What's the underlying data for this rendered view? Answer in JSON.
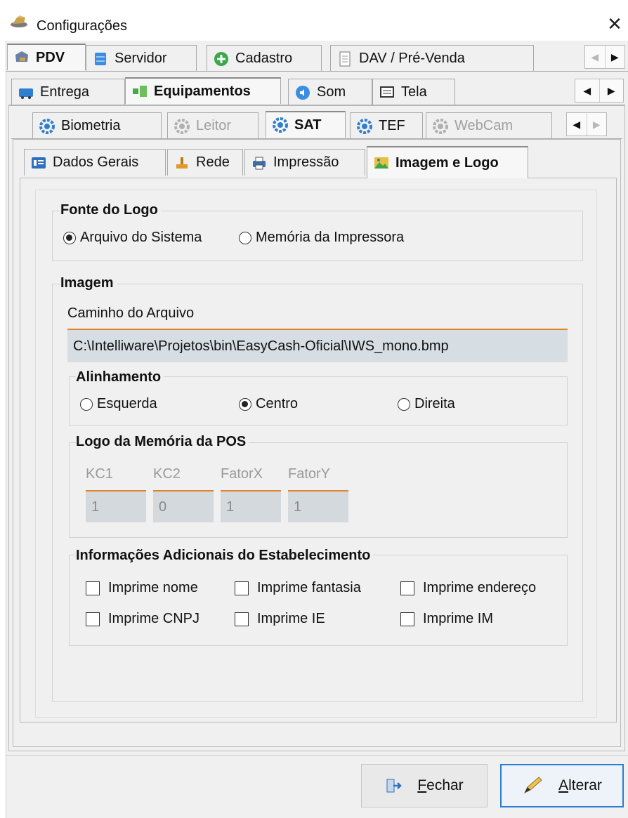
{
  "window": {
    "title": "Configurações",
    "close_glyph": "✕"
  },
  "tabs_level1": [
    {
      "label": "PDV",
      "icon": "pdv-icon",
      "active": true
    },
    {
      "label": "Servidor",
      "icon": "server-icon"
    },
    {
      "label": "Cadastro",
      "icon": "add-green-icon"
    },
    {
      "label": "DAV / Pré-Venda",
      "icon": "document-icon"
    }
  ],
  "tabs_level2": [
    {
      "label": "Entrega",
      "icon": "truck-icon"
    },
    {
      "label": "Equipamentos",
      "icon": "equipment-icon",
      "active": true
    },
    {
      "label": "Som",
      "icon": "sound-icon"
    },
    {
      "label": "Tela",
      "icon": "screen-icon"
    }
  ],
  "tabs_level3": [
    {
      "label": "Biometria",
      "icon": "gear-icon"
    },
    {
      "label": "Leitor",
      "icon": "gear-icon",
      "disabled": true
    },
    {
      "label": "SAT",
      "icon": "gear-icon",
      "active": true
    },
    {
      "label": "TEF",
      "icon": "gear-icon"
    },
    {
      "label": "WebCam",
      "icon": "gear-icon",
      "disabled": true
    }
  ],
  "tabs_level4": [
    {
      "label": "Dados Gerais",
      "icon": "data-icon"
    },
    {
      "label": "Rede",
      "icon": "network-icon"
    },
    {
      "label": "Impressão",
      "icon": "printer-icon"
    },
    {
      "label": "Imagem e Logo",
      "icon": "image-icon",
      "active": true
    }
  ],
  "scroll_arrows": {
    "left": "◀",
    "right": "▶"
  },
  "fonte_logo": {
    "title": "Fonte do Logo",
    "options": [
      {
        "label": "Arquivo do Sistema",
        "selected": true
      },
      {
        "label": "Memória da Impressora",
        "selected": false
      }
    ]
  },
  "imagem": {
    "title": "Imagem",
    "path_label": "Caminho do Arquivo",
    "path_value": "C:\\Intelliware\\Projetos\\bin\\EasyCash-Oficial\\IWS_mono.bmp",
    "alinhamento": {
      "title": "Alinhamento",
      "options": [
        {
          "label": "Esquerda",
          "selected": false
        },
        {
          "label": "Centro",
          "selected": true
        },
        {
          "label": "Direita",
          "selected": false
        }
      ]
    },
    "logo_memoria": {
      "title": "Logo da Memória da POS",
      "fields": [
        {
          "label": "KC1",
          "value": "1"
        },
        {
          "label": "KC2",
          "value": "0"
        },
        {
          "label": "FatorX",
          "value": "1"
        },
        {
          "label": "FatorY",
          "value": "1"
        }
      ]
    },
    "info_adicionais": {
      "title": "Informações Adicionais do Estabelecimento",
      "checks": [
        {
          "label": "Imprime nome",
          "checked": false
        },
        {
          "label": "Imprime fantasia",
          "checked": false
        },
        {
          "label": "Imprime endereço",
          "checked": false
        },
        {
          "label": "Imprime CNPJ",
          "checked": false
        },
        {
          "label": "Imprime IE",
          "checked": false
        },
        {
          "label": "Imprime IM",
          "checked": false
        }
      ]
    }
  },
  "buttons": {
    "fechar": {
      "prefix": "",
      "underline": "F",
      "rest": "echar"
    },
    "alterar": {
      "prefix": "",
      "underline": "A",
      "rest": "lterar"
    }
  }
}
